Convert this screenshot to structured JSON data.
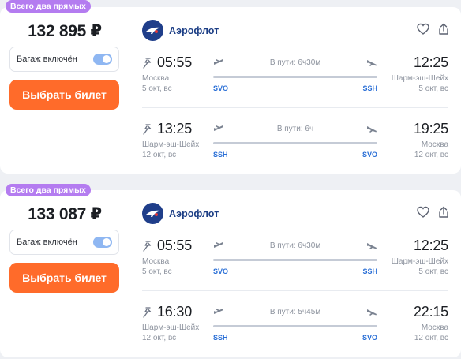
{
  "offers": [
    {
      "badge": "Всего два прямых",
      "price": "132 895 ₽",
      "baggage_label": "Багаж включён",
      "baggage_included": true,
      "buy_label": "Выбрать билет",
      "airline": "Аэрофлот",
      "segments": [
        {
          "dep_time": "05:55",
          "dep_city": "Москва",
          "dep_date": "5 окт, вс",
          "dep_code": "SVO",
          "duration": "В пути: 6ч30м",
          "arr_time": "12:25",
          "arr_city": "Шарм-эш-Шейх",
          "arr_date": "5 окт, вс",
          "arr_code": "SSH"
        },
        {
          "dep_time": "13:25",
          "dep_city": "Шарм-эш-Шейх",
          "dep_date": "12 окт, вс",
          "dep_code": "SSH",
          "duration": "В пути: 6ч",
          "arr_time": "19:25",
          "arr_city": "Москва",
          "arr_date": "12 окт, вс",
          "arr_code": "SVO"
        }
      ]
    },
    {
      "badge": "Всего два прямых",
      "price": "133 087 ₽",
      "baggage_label": "Багаж включён",
      "baggage_included": true,
      "buy_label": "Выбрать билет",
      "airline": "Аэрофлот",
      "segments": [
        {
          "dep_time": "05:55",
          "dep_city": "Москва",
          "dep_date": "5 окт, вс",
          "dep_code": "SVO",
          "duration": "В пути: 6ч30м",
          "arr_time": "12:25",
          "arr_city": "Шарм-эш-Шейх",
          "arr_date": "5 окт, вс",
          "arr_code": "SSH"
        },
        {
          "dep_time": "16:30",
          "dep_city": "Шарм-эш-Шейх",
          "dep_date": "12 окт, вс",
          "dep_code": "SSH",
          "duration": "В пути: 5ч45м",
          "arr_time": "22:15",
          "arr_city": "Москва",
          "arr_date": "12 окт, вс",
          "arr_code": "SVO"
        }
      ]
    }
  ],
  "icons": {
    "favorite": "heart-icon",
    "share": "share-icon",
    "pin": "pin-icon",
    "takeoff": "plane-takeoff-icon",
    "landing": "plane-landing-icon",
    "airline_logo": "aeroflot-logo"
  },
  "colors": {
    "accent_orange": "#ff6b2a",
    "badge_purple": "#b47cf0",
    "airline_blue": "#1d3f86",
    "code_blue": "#2a6fd6",
    "toggle_on": "#8fb7f2"
  }
}
